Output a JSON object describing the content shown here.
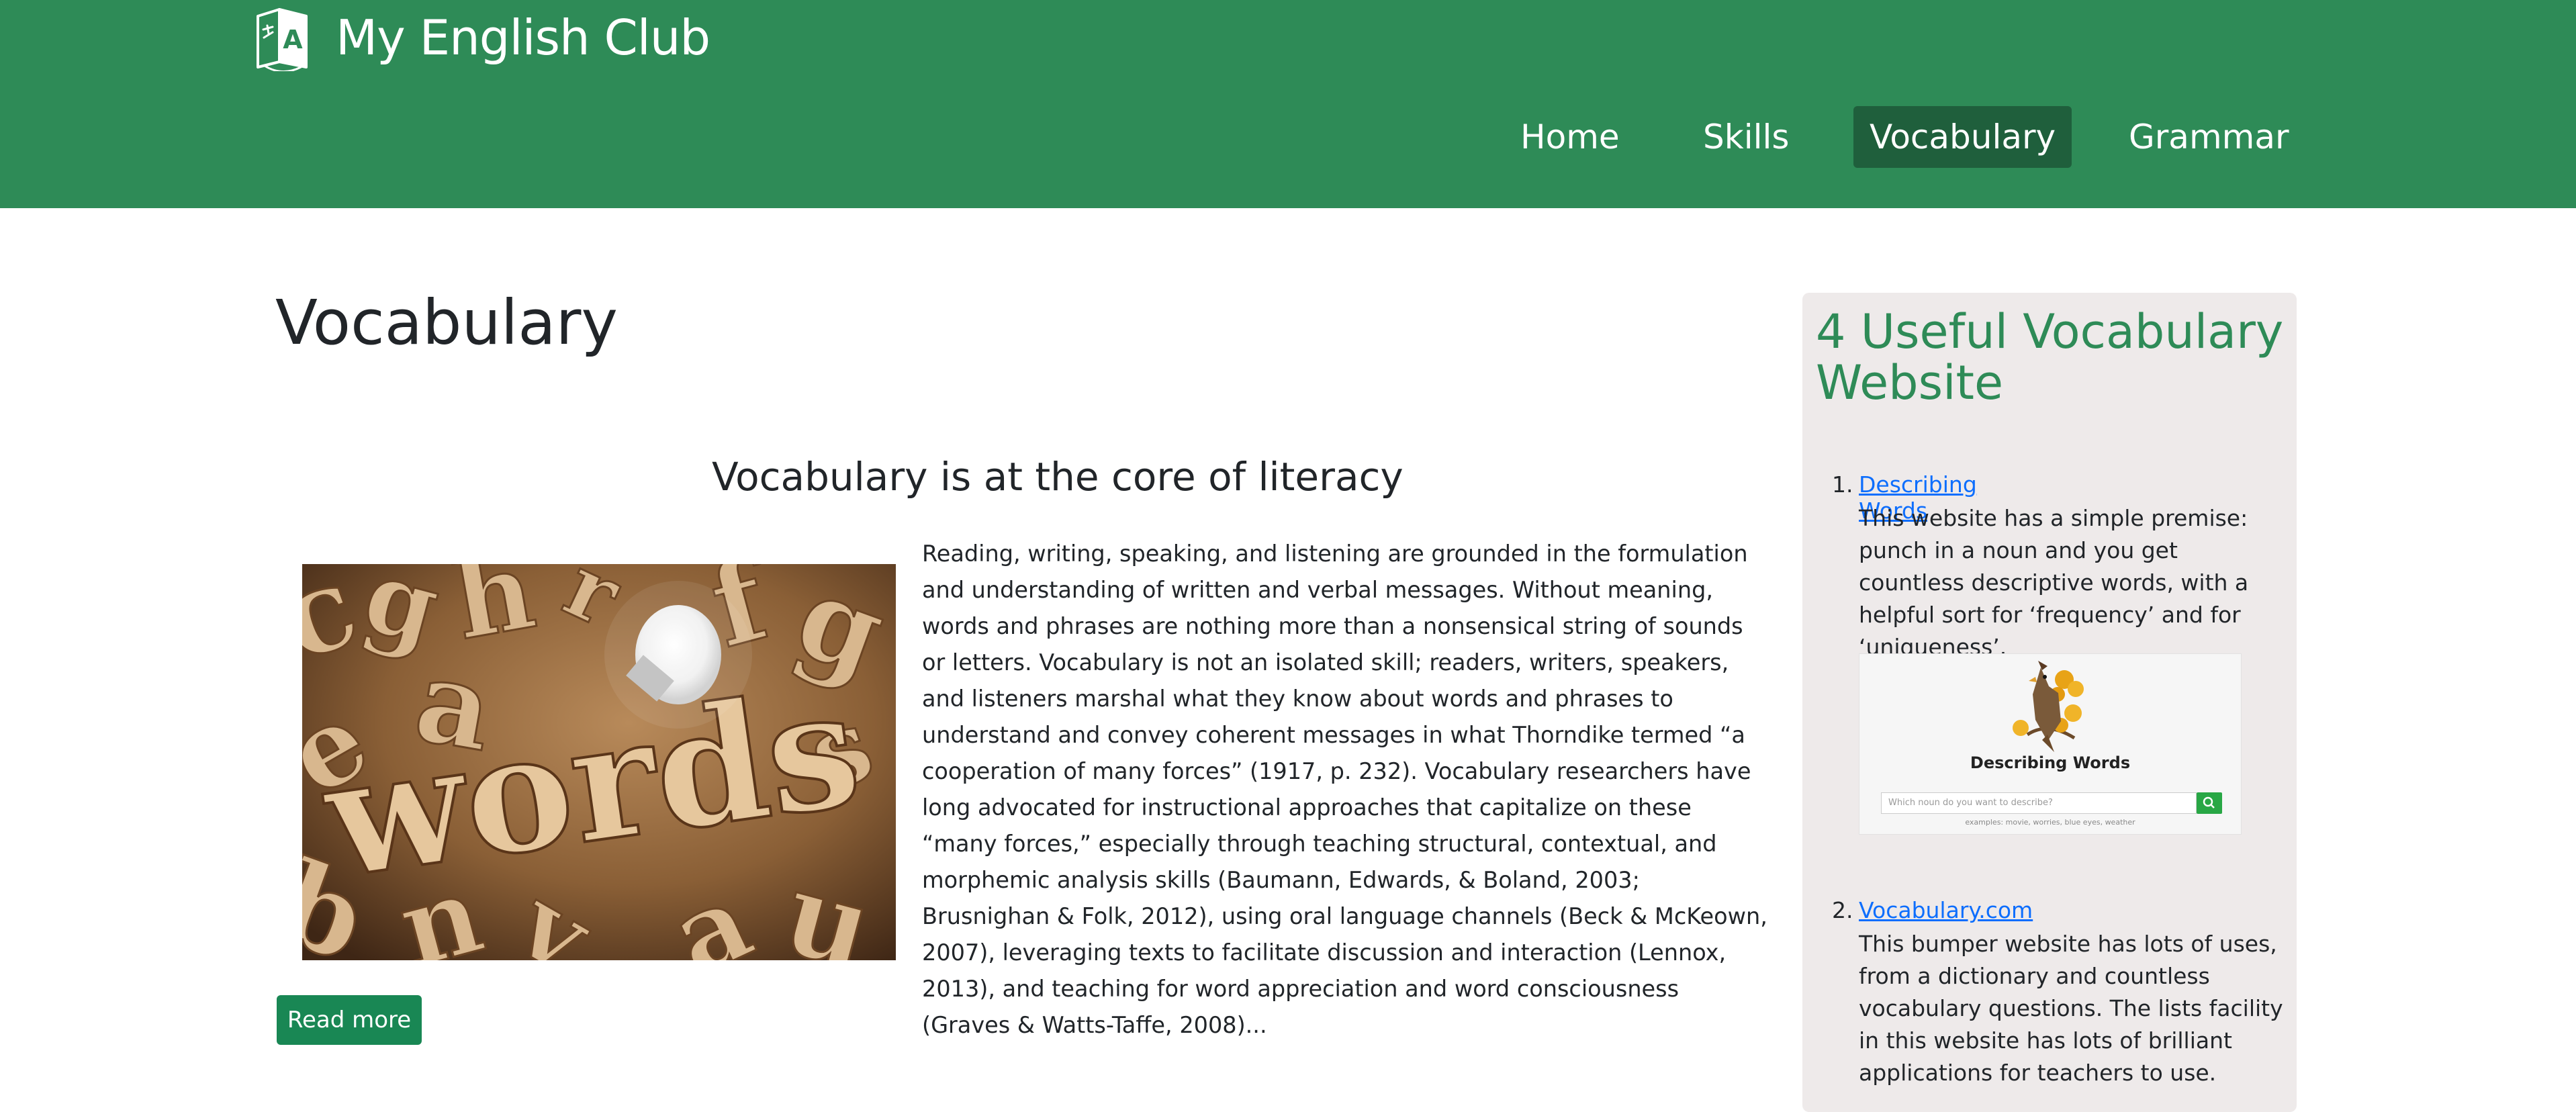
{
  "header": {
    "brand": "My English Club",
    "logo_icon": "book-language-icon",
    "nav": [
      {
        "label": "Home",
        "active": false
      },
      {
        "label": "Skills",
        "active": false
      },
      {
        "label": "Vocabulary",
        "active": true
      },
      {
        "label": "Grammar",
        "active": false
      }
    ]
  },
  "main": {
    "page_title": "Vocabulary",
    "article": {
      "title": "Vocabulary is at the core of literacy",
      "image_alt": "words",
      "body": "Reading, writing, speaking, and listening are grounded in the formulation and understanding of written and verbal messages. Without meaning, words and phrases are nothing more than a nonsensical string of sounds or letters. Vocabulary is not an isolated skill; readers, writers, speakers, and listeners marshal what they know about words and phrases to understand and convey coherent messages in what Thorndike termed “a cooperation of many forces” (1917, p. 232). Vocabulary researchers have long advocated for instructional approaches that capitalize on these “many forces,” especially through teaching structural, contextual, and morphemic analysis skills (Baumann, Edwards, & Boland, 2003; Brusnighan & Folk, 2012), using oral language channels (Beck & McKeown, 2007), leveraging texts to facilitate discussion and interaction (Lennox, 2013), and teaching for word appreciation and word consciousness (Graves & Watts-Taffe, 2008)...",
      "read_more": "Read more"
    }
  },
  "sidebar": {
    "title": "4 Useful Vocabulary Website",
    "items": [
      {
        "number": "1.",
        "link": "Describing Words",
        "description": "This website has a simple premise: punch in a noun and you get countless descriptive words, with a helpful sort for ‘frequency’ and for ‘uniqueness’.",
        "thumbnail": {
          "title": "Describing Words",
          "placeholder": "Which noun do you want to describe?",
          "examples": "examples: movie, worries, blue eyes, weather"
        }
      },
      {
        "number": "2.",
        "link": "Vocabulary.com",
        "description": "This bumper website has lots of uses, from a dictionary and countless vocabulary questions. The lists facility in this website has lots of brilliant applications for teachers to use."
      }
    ]
  },
  "colors": {
    "header_bg": "#2e8b57",
    "nav_active_bg": "#1f5f3c",
    "button_bg": "#198754",
    "sidebar_bg": "#eeeaea",
    "sidebar_title": "#2e8b57",
    "link": "#0d6efd"
  }
}
